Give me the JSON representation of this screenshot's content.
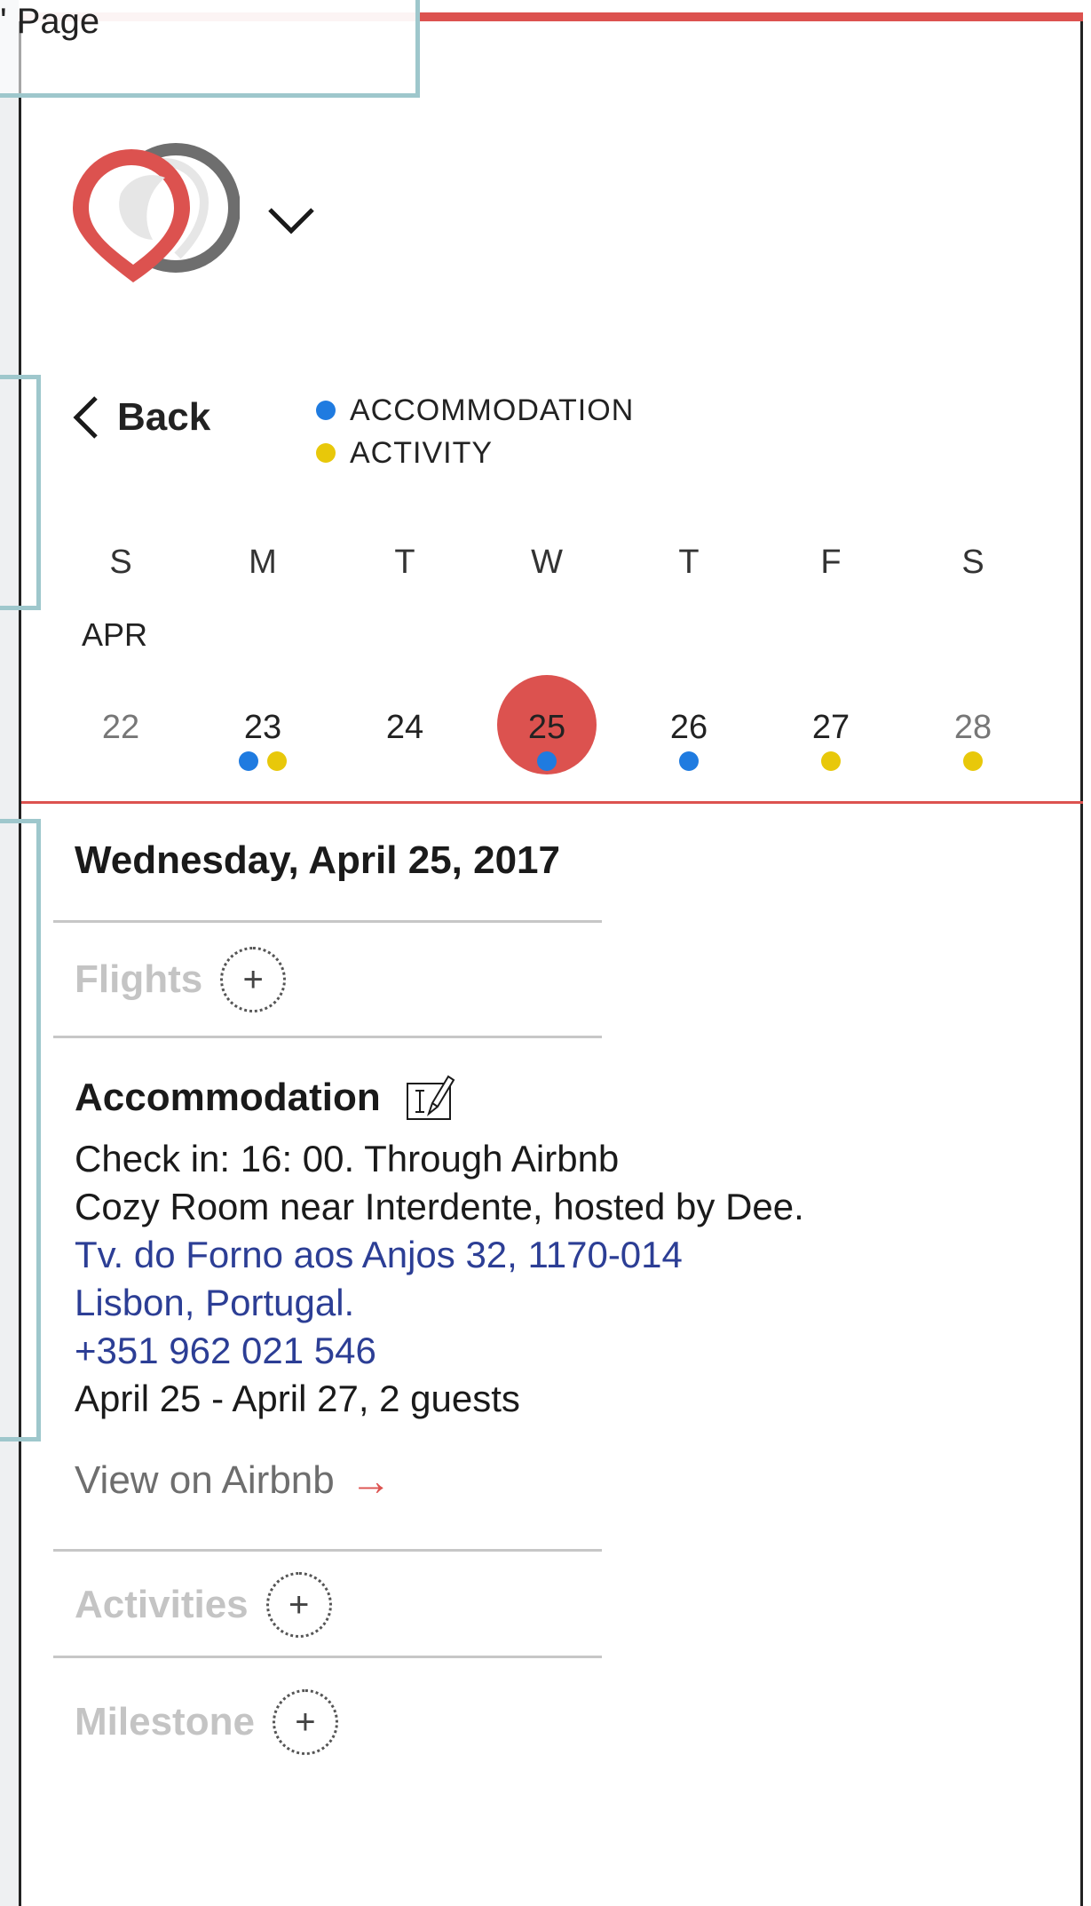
{
  "header": {
    "page_label": "' Page"
  },
  "nav": {
    "back_label": "Back"
  },
  "legend": [
    {
      "label": "ACCOMMODATION",
      "color": "#1f7be0"
    },
    {
      "label": "ACTIVITY",
      "color": "#e8c80a"
    }
  ],
  "calendar": {
    "weekdays": [
      "S",
      "M",
      "T",
      "W",
      "T",
      "F",
      "S"
    ],
    "month": "APR",
    "days": [
      {
        "num": "22",
        "muted": true,
        "dots": [],
        "selected": false
      },
      {
        "num": "23",
        "muted": false,
        "dots": [
          "accommodation",
          "activity"
        ],
        "selected": false
      },
      {
        "num": "24",
        "muted": false,
        "dots": [],
        "selected": false
      },
      {
        "num": "25",
        "muted": false,
        "dots": [
          "accommodation"
        ],
        "selected": true
      },
      {
        "num": "26",
        "muted": false,
        "dots": [
          "accommodation"
        ],
        "selected": false
      },
      {
        "num": "27",
        "muted": false,
        "dots": [
          "activity"
        ],
        "selected": false
      },
      {
        "num": "28",
        "muted": true,
        "dots": [
          "activity"
        ],
        "selected": false
      }
    ],
    "accent_color": "#dc524f"
  },
  "day_detail": {
    "date_heading": "Wednesday, April 25, 2017",
    "flights_label": "Flights",
    "add_symbol": "+",
    "accommodation": {
      "title": "Accommodation",
      "check_in": "Check in: 16: 00. Through Airbnb",
      "listing": "Cozy Room near Interdente, hosted by Dee.",
      "address_line1": "Tv. do Forno aos Anjos 32, 1170-014",
      "address_line2": "Lisbon, Portugal.",
      "phone": "+351 962 021 546",
      "dates": "April 25 - April 27, 2 guests",
      "view_link": "View on Airbnb",
      "arrow": "→"
    },
    "activities_label": "Activities",
    "milestone_label": "Milestone"
  }
}
